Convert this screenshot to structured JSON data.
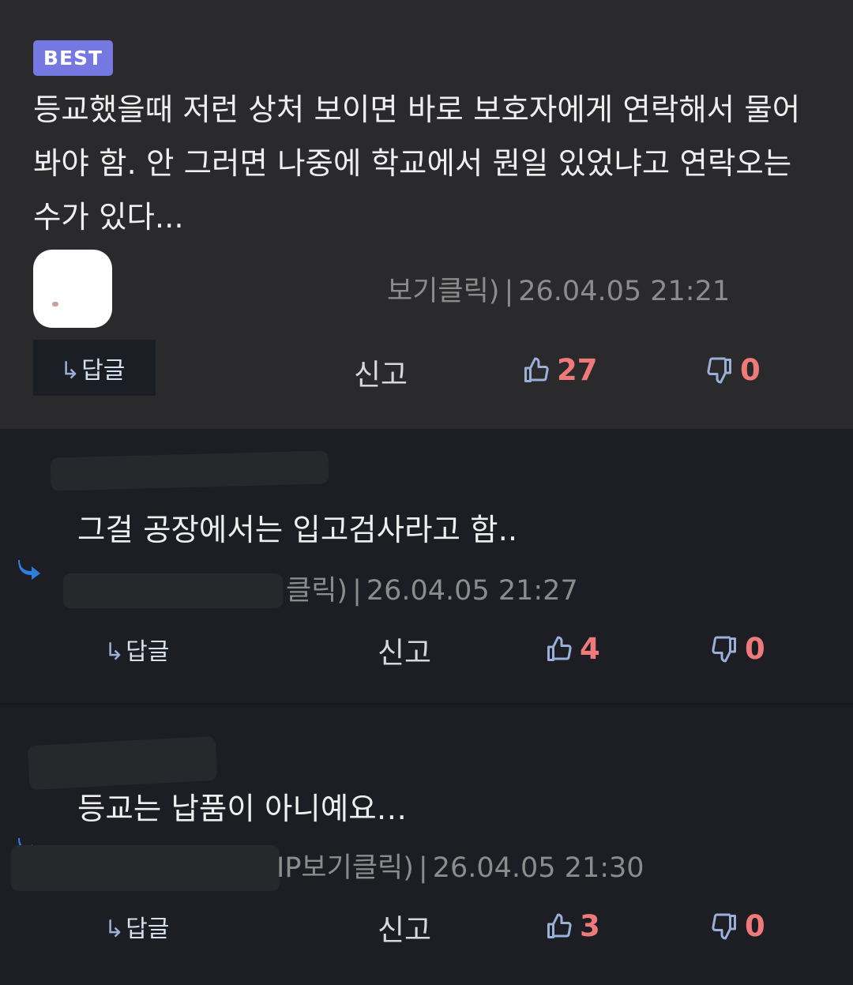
{
  "best": {
    "badge": "BEST",
    "text": "등교했을때 저런 상처 보이면 바로 보호자에게 연락해서 물어봐야 함. 안 그러면 나중에 학교에서 뭔일 있었냐고 연락오는 수가 있다...",
    "meta_fragment": "보기클릭)",
    "meta_sep": "|",
    "timestamp": "26.04.05 21:21",
    "reply_label": "답글",
    "report_label": "신고",
    "likes": "27",
    "dislikes": "0"
  },
  "comments": [
    {
      "text": "그걸 공장에서는 입고검사라고 함..",
      "meta_fragment": "클릭)",
      "meta_sep": "|",
      "timestamp": "26.04.05 21:27",
      "reply_label": "답글",
      "report_label": "신고",
      "likes": "4",
      "dislikes": "0"
    },
    {
      "text": "등교는 납품이 아니예요…",
      "meta_fragment": "IP보기클릭)",
      "meta_sep": "|",
      "timestamp": "26.04.05 21:30",
      "reply_label": "답글",
      "report_label": "신고",
      "likes": "3",
      "dislikes": "0"
    }
  ],
  "icons": {
    "reply_arrow": "↳",
    "thumbs_up": "thumbs-up-icon",
    "thumbs_down": "thumbs-down-icon",
    "nested_reply": "reply-arrow-icon"
  },
  "colors": {
    "badge": "#7478e0",
    "vote_count": "#f07a7a",
    "icon_blue": "#9ab0d8",
    "nested_arrow": "#2f7de0"
  }
}
